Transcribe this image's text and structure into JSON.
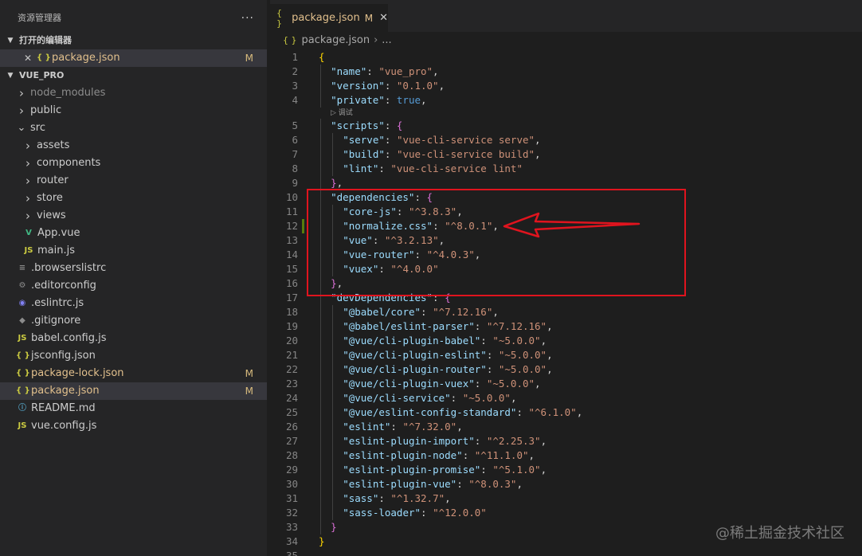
{
  "sidebar": {
    "title": "资源管理器",
    "more": "···",
    "open_editors": {
      "label": "打开的编辑器",
      "items": [
        {
          "name": "package.json",
          "badge": "M"
        }
      ]
    },
    "project": {
      "label": "VUE_PRO",
      "tree": [
        {
          "name": "node_modules",
          "kind": "folder",
          "depth": 0,
          "open": false,
          "dim": true
        },
        {
          "name": "public",
          "kind": "folder",
          "depth": 0,
          "open": false
        },
        {
          "name": "src",
          "kind": "folder",
          "depth": 0,
          "open": true
        },
        {
          "name": "assets",
          "kind": "folder",
          "depth": 1,
          "open": false
        },
        {
          "name": "components",
          "kind": "folder",
          "depth": 1,
          "open": false
        },
        {
          "name": "router",
          "kind": "folder",
          "depth": 1,
          "open": false
        },
        {
          "name": "store",
          "kind": "folder",
          "depth": 1,
          "open": false
        },
        {
          "name": "views",
          "kind": "folder",
          "depth": 1,
          "open": false
        },
        {
          "name": "App.vue",
          "kind": "file",
          "icon": "vue",
          "depth": 1
        },
        {
          "name": "main.js",
          "kind": "file",
          "icon": "js",
          "depth": 1
        },
        {
          "name": ".browserslistrc",
          "kind": "file",
          "icon": "browserslist",
          "depth": 0
        },
        {
          "name": ".editorconfig",
          "kind": "file",
          "icon": "gear",
          "depth": 0
        },
        {
          "name": ".eslintrc.js",
          "kind": "file",
          "icon": "eslint",
          "depth": 0
        },
        {
          "name": ".gitignore",
          "kind": "file",
          "icon": "git",
          "depth": 0
        },
        {
          "name": "babel.config.js",
          "kind": "file",
          "icon": "js",
          "depth": 0
        },
        {
          "name": "jsconfig.json",
          "kind": "file",
          "icon": "json",
          "depth": 0
        },
        {
          "name": "package-lock.json",
          "kind": "file",
          "icon": "json",
          "depth": 0,
          "badge": "M"
        },
        {
          "name": "package.json",
          "kind": "file",
          "icon": "json",
          "depth": 0,
          "badge": "M",
          "selected": true
        },
        {
          "name": "README.md",
          "kind": "file",
          "icon": "info",
          "depth": 0
        },
        {
          "name": "vue.config.js",
          "kind": "file",
          "icon": "js",
          "depth": 0
        }
      ]
    }
  },
  "editor": {
    "tab": {
      "label": "package.json",
      "badge": "M",
      "close": "✕"
    },
    "breadcrumb": {
      "file": "package.json",
      "rest": "..."
    },
    "codelens": "调试",
    "lines": [
      {
        "n": "1",
        "ind": 0,
        "t": [
          [
            "{",
            "br1"
          ]
        ]
      },
      {
        "n": "2",
        "ind": 1,
        "t": [
          [
            "\"name\"",
            "k"
          ],
          [
            ": ",
            "p"
          ],
          [
            "\"vue_pro\"",
            "s"
          ],
          [
            ",",
            "p"
          ]
        ]
      },
      {
        "n": "3",
        "ind": 1,
        "t": [
          [
            "\"version\"",
            "k"
          ],
          [
            ": ",
            "p"
          ],
          [
            "\"0.1.0\"",
            "s"
          ],
          [
            ",",
            "p"
          ]
        ]
      },
      {
        "n": "4",
        "ind": 1,
        "t": [
          [
            "\"private\"",
            "k"
          ],
          [
            ": ",
            "p"
          ],
          [
            "true",
            "b"
          ],
          [
            ",",
            "p"
          ]
        ]
      },
      {
        "n": "5",
        "ind": 1,
        "t": [
          [
            "\"scripts\"",
            "k"
          ],
          [
            ": ",
            "p"
          ],
          [
            "{",
            "br2"
          ]
        ]
      },
      {
        "n": "6",
        "ind": 2,
        "t": [
          [
            "\"serve\"",
            "k"
          ],
          [
            ": ",
            "p"
          ],
          [
            "\"vue-cli-service serve\"",
            "s"
          ],
          [
            ",",
            "p"
          ]
        ]
      },
      {
        "n": "7",
        "ind": 2,
        "t": [
          [
            "\"build\"",
            "k"
          ],
          [
            ": ",
            "p"
          ],
          [
            "\"vue-cli-service build\"",
            "s"
          ],
          [
            ",",
            "p"
          ]
        ]
      },
      {
        "n": "8",
        "ind": 2,
        "t": [
          [
            "\"lint\"",
            "k"
          ],
          [
            ": ",
            "p"
          ],
          [
            "\"vue-cli-service lint\"",
            "s"
          ]
        ]
      },
      {
        "n": "9",
        "ind": 1,
        "t": [
          [
            "}",
            "br2"
          ],
          [
            ",",
            "p"
          ]
        ]
      },
      {
        "n": "10",
        "ind": 1,
        "t": [
          [
            "\"dependencies\"",
            "k"
          ],
          [
            ": ",
            "p"
          ],
          [
            "{",
            "br2"
          ]
        ]
      },
      {
        "n": "11",
        "ind": 2,
        "t": [
          [
            "\"core-js\"",
            "k"
          ],
          [
            ": ",
            "p"
          ],
          [
            "\"^3.8.3\"",
            "s"
          ],
          [
            ",",
            "p"
          ]
        ]
      },
      {
        "n": "12",
        "ind": 2,
        "mark": true,
        "t": [
          [
            "\"normalize.css\"",
            "k"
          ],
          [
            ": ",
            "p"
          ],
          [
            "\"^8.0.1\"",
            "s"
          ],
          [
            ",",
            "p"
          ]
        ]
      },
      {
        "n": "13",
        "ind": 2,
        "t": [
          [
            "\"vue\"",
            "k"
          ],
          [
            ": ",
            "p"
          ],
          [
            "\"^3.2.13\"",
            "s"
          ],
          [
            ",",
            "p"
          ]
        ]
      },
      {
        "n": "14",
        "ind": 2,
        "t": [
          [
            "\"vue-router\"",
            "k"
          ],
          [
            ": ",
            "p"
          ],
          [
            "\"^4.0.3\"",
            "s"
          ],
          [
            ",",
            "p"
          ]
        ]
      },
      {
        "n": "15",
        "ind": 2,
        "t": [
          [
            "\"vuex\"",
            "k"
          ],
          [
            ": ",
            "p"
          ],
          [
            "\"^4.0.0\"",
            "s"
          ]
        ]
      },
      {
        "n": "16",
        "ind": 1,
        "t": [
          [
            "}",
            "br2"
          ],
          [
            ",",
            "p"
          ]
        ]
      },
      {
        "n": "17",
        "ind": 1,
        "t": [
          [
            "\"devDependencies\"",
            "k"
          ],
          [
            ": ",
            "p"
          ],
          [
            "{",
            "br2"
          ]
        ]
      },
      {
        "n": "18",
        "ind": 2,
        "t": [
          [
            "\"@babel/core\"",
            "k"
          ],
          [
            ": ",
            "p"
          ],
          [
            "\"^7.12.16\"",
            "s"
          ],
          [
            ",",
            "p"
          ]
        ]
      },
      {
        "n": "19",
        "ind": 2,
        "t": [
          [
            "\"@babel/eslint-parser\"",
            "k"
          ],
          [
            ": ",
            "p"
          ],
          [
            "\"^7.12.16\"",
            "s"
          ],
          [
            ",",
            "p"
          ]
        ]
      },
      {
        "n": "20",
        "ind": 2,
        "t": [
          [
            "\"@vue/cli-plugin-babel\"",
            "k"
          ],
          [
            ": ",
            "p"
          ],
          [
            "\"~5.0.0\"",
            "s"
          ],
          [
            ",",
            "p"
          ]
        ]
      },
      {
        "n": "21",
        "ind": 2,
        "t": [
          [
            "\"@vue/cli-plugin-eslint\"",
            "k"
          ],
          [
            ": ",
            "p"
          ],
          [
            "\"~5.0.0\"",
            "s"
          ],
          [
            ",",
            "p"
          ]
        ]
      },
      {
        "n": "22",
        "ind": 2,
        "t": [
          [
            "\"@vue/cli-plugin-router\"",
            "k"
          ],
          [
            ": ",
            "p"
          ],
          [
            "\"~5.0.0\"",
            "s"
          ],
          [
            ",",
            "p"
          ]
        ]
      },
      {
        "n": "23",
        "ind": 2,
        "t": [
          [
            "\"@vue/cli-plugin-vuex\"",
            "k"
          ],
          [
            ": ",
            "p"
          ],
          [
            "\"~5.0.0\"",
            "s"
          ],
          [
            ",",
            "p"
          ]
        ]
      },
      {
        "n": "24",
        "ind": 2,
        "t": [
          [
            "\"@vue/cli-service\"",
            "k"
          ],
          [
            ": ",
            "p"
          ],
          [
            "\"~5.0.0\"",
            "s"
          ],
          [
            ",",
            "p"
          ]
        ]
      },
      {
        "n": "25",
        "ind": 2,
        "t": [
          [
            "\"@vue/eslint-config-standard\"",
            "k"
          ],
          [
            ": ",
            "p"
          ],
          [
            "\"^6.1.0\"",
            "s"
          ],
          [
            ",",
            "p"
          ]
        ]
      },
      {
        "n": "26",
        "ind": 2,
        "t": [
          [
            "\"eslint\"",
            "k"
          ],
          [
            ": ",
            "p"
          ],
          [
            "\"^7.32.0\"",
            "s"
          ],
          [
            ",",
            "p"
          ]
        ]
      },
      {
        "n": "27",
        "ind": 2,
        "t": [
          [
            "\"eslint-plugin-import\"",
            "k"
          ],
          [
            ": ",
            "p"
          ],
          [
            "\"^2.25.3\"",
            "s"
          ],
          [
            ",",
            "p"
          ]
        ]
      },
      {
        "n": "28",
        "ind": 2,
        "t": [
          [
            "\"eslint-plugin-node\"",
            "k"
          ],
          [
            ": ",
            "p"
          ],
          [
            "\"^11.1.0\"",
            "s"
          ],
          [
            ",",
            "p"
          ]
        ]
      },
      {
        "n": "29",
        "ind": 2,
        "t": [
          [
            "\"eslint-plugin-promise\"",
            "k"
          ],
          [
            ": ",
            "p"
          ],
          [
            "\"^5.1.0\"",
            "s"
          ],
          [
            ",",
            "p"
          ]
        ]
      },
      {
        "n": "30",
        "ind": 2,
        "t": [
          [
            "\"eslint-plugin-vue\"",
            "k"
          ],
          [
            ": ",
            "p"
          ],
          [
            "\"^8.0.3\"",
            "s"
          ],
          [
            ",",
            "p"
          ]
        ]
      },
      {
        "n": "31",
        "ind": 2,
        "t": [
          [
            "\"sass\"",
            "k"
          ],
          [
            ": ",
            "p"
          ],
          [
            "\"^1.32.7\"",
            "s"
          ],
          [
            ",",
            "p"
          ]
        ]
      },
      {
        "n": "32",
        "ind": 2,
        "t": [
          [
            "\"sass-loader\"",
            "k"
          ],
          [
            ": ",
            "p"
          ],
          [
            "\"^12.0.0\"",
            "s"
          ]
        ]
      },
      {
        "n": "33",
        "ind": 1,
        "t": [
          [
            "}",
            "br2"
          ]
        ]
      },
      {
        "n": "34",
        "ind": 0,
        "t": [
          [
            "}",
            "br1"
          ]
        ]
      },
      {
        "n": "35",
        "ind": 0,
        "t": []
      }
    ]
  },
  "annotation": {
    "color": "#e0141e"
  },
  "watermark": "@稀土掘金技术社区"
}
